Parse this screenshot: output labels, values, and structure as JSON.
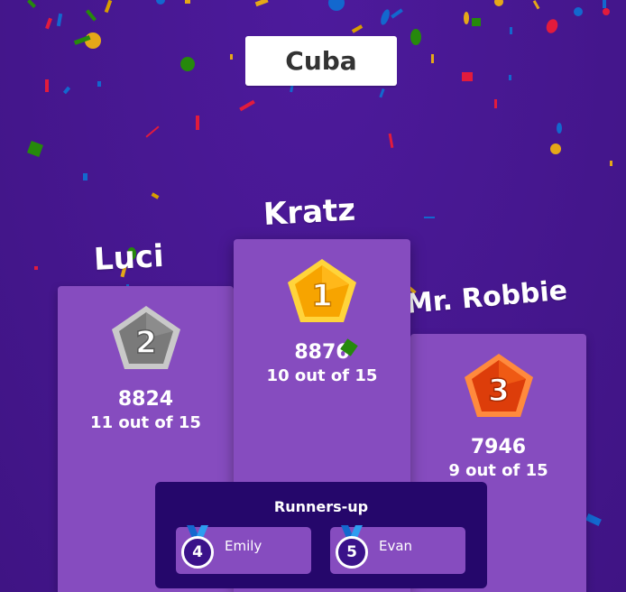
{
  "quiz": {
    "title": "Cuba"
  },
  "podium": {
    "first": {
      "rank": "1",
      "name": "Kratz",
      "score": "8876",
      "correct": "10 out of 15",
      "medal_color": "#f7b514",
      "medal_icon": "gold-medal-icon"
    },
    "second": {
      "rank": "2",
      "name": "Luci",
      "score": "8824",
      "correct": "11 out of 15",
      "medal_color": "#8a8a8a",
      "medal_icon": "silver-medal-icon"
    },
    "third": {
      "rank": "3",
      "name": "Mr. Robbie",
      "score": "7946",
      "correct": "9 out of 15",
      "medal_color": "#e8530e",
      "medal_icon": "bronze-medal-icon"
    }
  },
  "runners_up": {
    "title": "Runners-up",
    "items": [
      {
        "rank": "4",
        "name": "Emily"
      },
      {
        "rank": "5",
        "name": "Evan"
      }
    ]
  },
  "colors": {
    "background": "#46178f",
    "podium": "#864cbf",
    "runners_panel": "#25076b"
  }
}
